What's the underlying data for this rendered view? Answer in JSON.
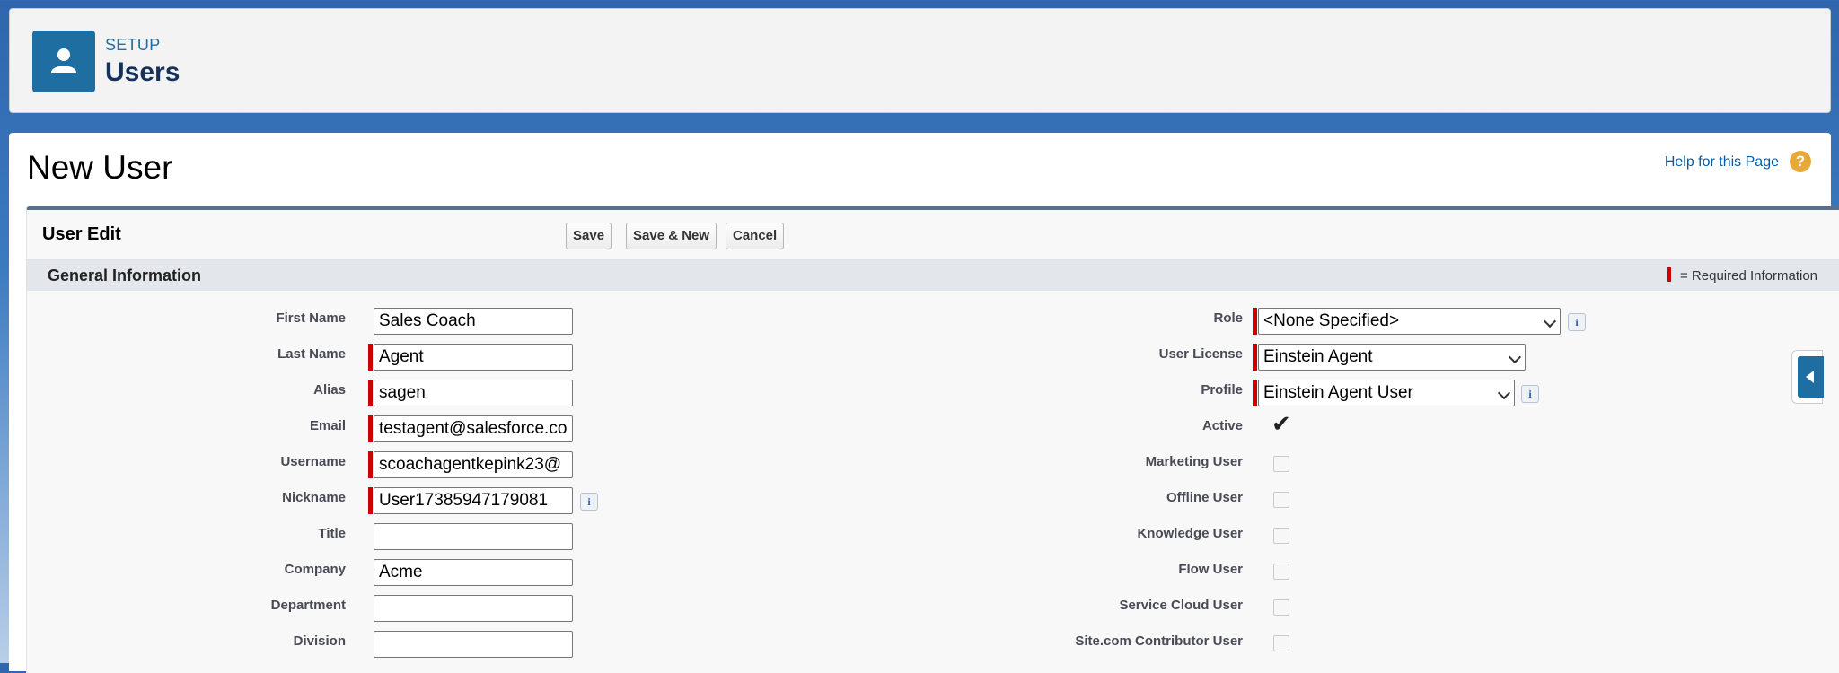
{
  "header": {
    "breadcrumb": "SETUP",
    "title": "Users",
    "icon": "user-icon"
  },
  "page": {
    "title": "New User",
    "help_link": "Help for this Page",
    "help_icon": "?"
  },
  "block": {
    "title": "User Edit",
    "buttons": {
      "save": "Save",
      "save_new": "Save & New",
      "cancel": "Cancel"
    }
  },
  "section": {
    "title": "General Information",
    "required_legend": " = Required Information"
  },
  "left_fields": {
    "first_name": {
      "label": "First Name",
      "value": "Sales Coach"
    },
    "last_name": {
      "label": "Last Name",
      "value": "Agent"
    },
    "alias": {
      "label": "Alias",
      "value": "sagen"
    },
    "email": {
      "label": "Email",
      "value": "testagent@salesforce.com"
    },
    "username": {
      "label": "Username",
      "value": "scoachagentkepink23@"
    },
    "nickname": {
      "label": "Nickname",
      "value": "User17385947179081"
    },
    "title": {
      "label": "Title",
      "value": ""
    },
    "company": {
      "label": "Company",
      "value": "Acme"
    },
    "department": {
      "label": "Department",
      "value": ""
    },
    "division": {
      "label": "Division",
      "value": ""
    }
  },
  "right_fields": {
    "role": {
      "label": "Role",
      "value": "<None Specified>"
    },
    "user_license": {
      "label": "User License",
      "value": "Einstein Agent"
    },
    "profile": {
      "label": "Profile",
      "value": "Einstein Agent User"
    },
    "active": {
      "label": "Active",
      "checked": true
    },
    "marketing_user": {
      "label": "Marketing User",
      "checked": false
    },
    "offline_user": {
      "label": "Offline User",
      "checked": false
    },
    "knowledge_user": {
      "label": "Knowledge User",
      "checked": false
    },
    "flow_user": {
      "label": "Flow User",
      "checked": false
    },
    "service_cloud_user": {
      "label": "Service Cloud User",
      "checked": false
    },
    "site_contributor_user": {
      "label": "Site.com Contributor User",
      "checked": false
    }
  },
  "info_icon": "i",
  "checkmark": "✔"
}
